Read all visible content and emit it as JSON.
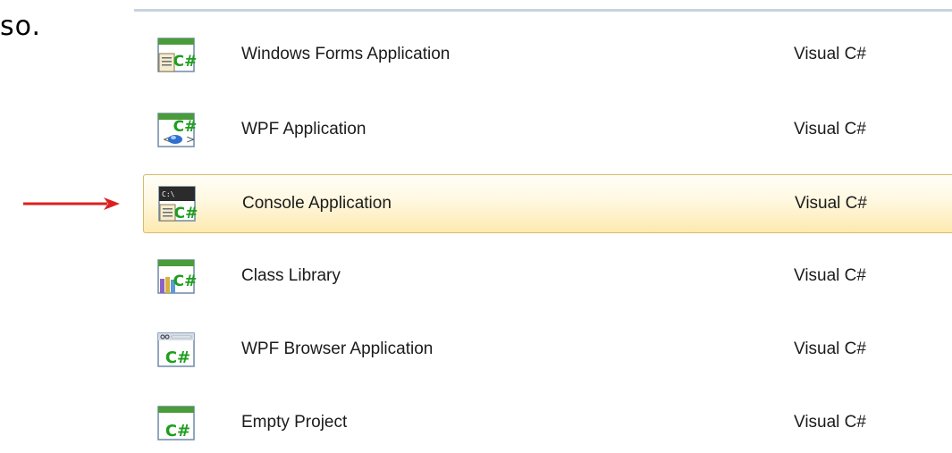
{
  "leading_text": "so.",
  "colors": {
    "arrow": "#dd1f1f",
    "selection_top": "#fffef8",
    "selection_bottom": "#fdeab0",
    "selection_border": "#d9ba6a",
    "csharp_green": "#1e9e1e"
  },
  "templates": [
    {
      "name": "Windows Forms Application",
      "language": "Visual C#",
      "icon": "windows-forms-icon"
    },
    {
      "name": "WPF Application",
      "language": "Visual C#",
      "icon": "wpf-app-icon"
    },
    {
      "name": "Console Application",
      "language": "Visual C#",
      "icon": "console-app-icon",
      "selected": true
    },
    {
      "name": "Class Library",
      "language": "Visual C#",
      "icon": "class-library-icon"
    },
    {
      "name": "WPF Browser Application",
      "language": "Visual C#",
      "icon": "wpf-browser-icon"
    },
    {
      "name": "Empty Project",
      "language": "Visual C#",
      "icon": "empty-project-icon"
    }
  ]
}
